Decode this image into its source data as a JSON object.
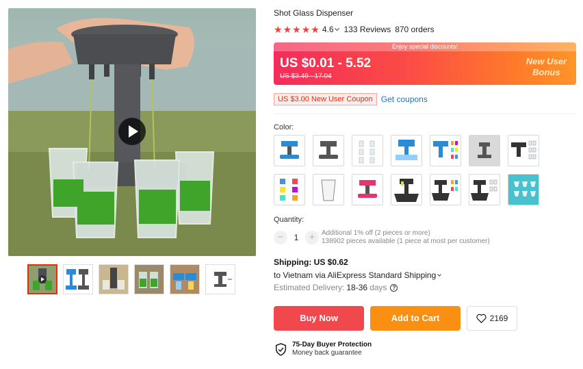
{
  "product": {
    "title": "Shot Glass Dispenser",
    "rating": "4.6",
    "reviews": "133 Reviews",
    "orders": "870 orders",
    "star_color": "#f0403c"
  },
  "price_banner": {
    "discount_text": "Enjoy special discounts!",
    "price_range": "US $0.01 - 5.52",
    "original_price": "US $3.49 - 17.04",
    "bonus_line1": "New User",
    "bonus_line2": "Bonus"
  },
  "coupon": {
    "tag": "US $3.00 New User Coupon",
    "link": "Get coupons"
  },
  "color": {
    "label": "Color:",
    "swatches": [
      "gray-blue-dispenser",
      "gray-dispenser",
      "glasses-set-clear",
      "blue-dispenser-glasses",
      "blue-dispenser-color-glasses",
      "gray-dispenser-photo",
      "black-dispenser-glasses",
      "color-glasses-set",
      "single-shot-glass",
      "pink-dispenser",
      "black-dispenser-base",
      "black-dispenser-base-glasses",
      "black-dispenser-base-clear",
      "cyan-glasses-set"
    ]
  },
  "quantity": {
    "label": "Quantity:",
    "value": "1",
    "minus": "−",
    "plus": "+",
    "note_line1": "Additional 1% off (2 pieces or more)",
    "note_line2": "138902 pieces available (1 piece at most per customer)"
  },
  "shipping": {
    "title": "Shipping: US $0.62",
    "to": "to Vietnam via AliExpress Standard Shipping",
    "delivery_label": "Estimated Delivery:",
    "delivery_days": "18-36",
    "delivery_unit": "days",
    "help": "?"
  },
  "actions": {
    "buy_now": "Buy Now",
    "add_to_cart": "Add to Cart",
    "wishlist_count": "2169"
  },
  "protection": {
    "title": "75-Day Buyer Protection",
    "subtitle": "Money back guarantee"
  }
}
